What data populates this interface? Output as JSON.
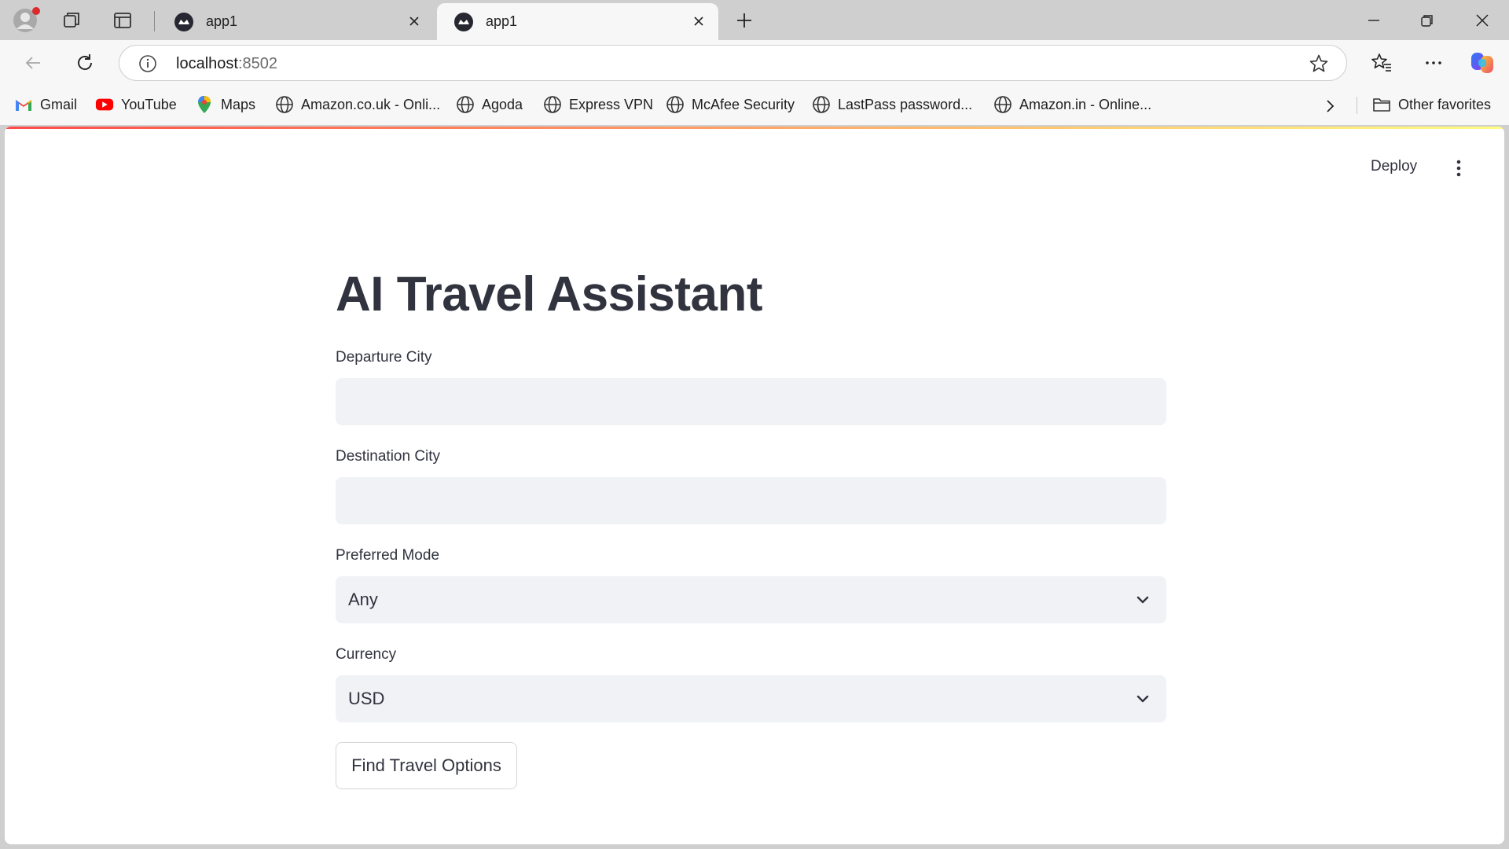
{
  "browser": {
    "tabs": [
      {
        "title": "app1",
        "active": false
      },
      {
        "title": "app1",
        "active": true
      }
    ],
    "address": {
      "host": "localhost",
      "port": ":8502"
    },
    "bookmarks": [
      {
        "label": "Gmail",
        "icon": "gmail-icon"
      },
      {
        "label": "YouTube",
        "icon": "youtube-icon"
      },
      {
        "label": "Maps",
        "icon": "maps-icon"
      },
      {
        "label": "Amazon.co.uk - Onli...",
        "icon": "globe-icon"
      },
      {
        "label": "Agoda",
        "icon": "globe-icon"
      },
      {
        "label": "Express VPN",
        "icon": "globe-icon"
      },
      {
        "label": "McAfee Security",
        "icon": "globe-icon"
      },
      {
        "label": "LastPass password...",
        "icon": "globe-icon"
      },
      {
        "label": "Amazon.in - Online...",
        "icon": "globe-icon"
      }
    ],
    "other_favorites": "Other favorites"
  },
  "app": {
    "deploy_label": "Deploy",
    "title": "AI Travel Assistant",
    "fields": {
      "departure": {
        "label": "Departure City",
        "value": ""
      },
      "destination": {
        "label": "Destination City",
        "value": ""
      },
      "mode": {
        "label": "Preferred Mode",
        "value": "Any"
      },
      "currency": {
        "label": "Currency",
        "value": "USD"
      }
    },
    "submit_label": "Find Travel Options"
  },
  "colors": {
    "accent": "#ff4b4b",
    "text": "#31333f",
    "input_bg": "#f0f2f6"
  }
}
